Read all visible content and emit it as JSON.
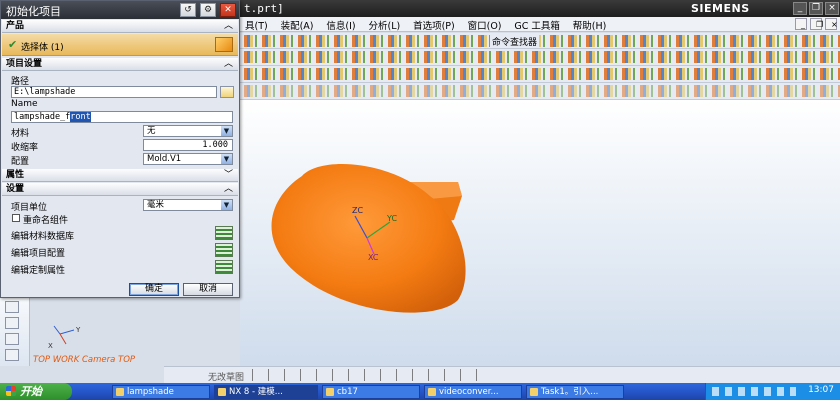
{
  "window": {
    "title_fragment": "t.prt]",
    "brand": "SIEMENS"
  },
  "menu": {
    "items": [
      "具(T)",
      "装配(A)",
      "信息(I)",
      "分析(L)",
      "首选项(P)",
      "窗口(O)",
      "GC 工具箱",
      "帮助(H)"
    ]
  },
  "toolbar": {
    "command_finder": "命令查找器"
  },
  "viewport": {
    "view_label": "TOP WORK Camera TOP",
    "triad": {
      "zc": "ZC",
      "yc": "YC",
      "xc": "XC",
      "x": "X",
      "y": "Y"
    }
  },
  "selection_bar": {
    "sketch_label": "无改草图"
  },
  "dialog": {
    "title": "初始化项目",
    "product_group": "产品",
    "select_body": "选择体 (1)",
    "settings_group": "项目设置",
    "path_label": "路径",
    "path_value": "E:\\lampshade",
    "name_label": "Name",
    "name_prefix": "lampshade_f",
    "name_selected": "ront",
    "material_label": "材料",
    "material_value": "无",
    "shrinkage_label": "收缩率",
    "shrinkage_value": "1.000",
    "config_label": "配置",
    "config_value": "Mold.V1",
    "attributes_group": "属性",
    "setup_group": "设置",
    "unit_label": "项目单位",
    "unit_value": "毫米",
    "rename_label": "重命名组件",
    "edit_material_db": "编辑材料数据库",
    "edit_project_config": "编辑项目配置",
    "edit_custom_attr": "编辑定制属性",
    "ok": "确定",
    "cancel": "取消"
  },
  "taskbar": {
    "start": "开始",
    "tasks": [
      "lampshade",
      "NX 8 - 建模...",
      "cb17",
      "videoconver...",
      "Task1。引入..."
    ],
    "clock": "13:07"
  }
}
